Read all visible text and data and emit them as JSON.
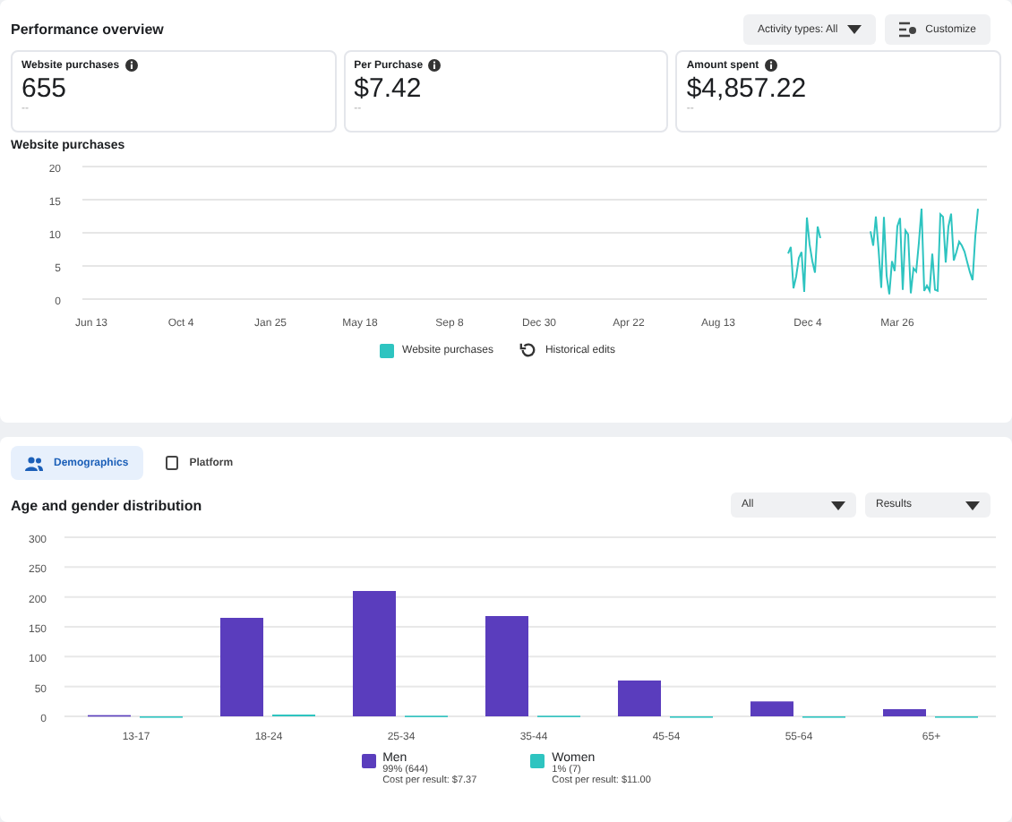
{
  "performance": {
    "title": "Performance overview",
    "activity_filter": "Activity types: All",
    "customize": "Customize",
    "metrics": [
      {
        "label": "Website purchases",
        "value": "655",
        "delta": "--"
      },
      {
        "label": "Per Purchase",
        "value": "$7.42",
        "delta": "--"
      },
      {
        "label": "Amount spent",
        "value": "$4,857.22",
        "delta": "--"
      }
    ],
    "trend": {
      "title": "Website purchases",
      "yticks": [
        "20",
        "15",
        "10",
        "5",
        "0"
      ],
      "xlabels": [
        "Jun 13",
        "Oct 4",
        "Jan 25",
        "May 18",
        "Sep 8",
        "Dec 30",
        "Apr 22",
        "Aug 13",
        "Dec 4",
        "Mar 26"
      ],
      "legend": [
        {
          "kind": "swatch",
          "label": "Website purchases",
          "color": "#2ec4c0"
        },
        {
          "kind": "history",
          "label": "Historical edits"
        }
      ]
    }
  },
  "breakdown": {
    "tabs": [
      {
        "label": "Demographics",
        "selected": true
      },
      {
        "label": "Platform",
        "selected": false
      }
    ],
    "title": "Age and gender distribution",
    "filters": [
      "All",
      "Results"
    ],
    "chart_data": {
      "type": "bar",
      "categories": [
        "13-17",
        "18-24",
        "25-34",
        "35-44",
        "45-54",
        "55-64",
        "65+"
      ],
      "series": [
        {
          "name": "Men",
          "color": "#5a3dbd",
          "values": [
            2,
            165,
            210,
            168,
            60,
            25,
            12
          ]
        },
        {
          "name": "Women",
          "color": "#2ec4c0",
          "values": [
            0,
            3,
            1,
            1,
            0,
            0,
            0
          ]
        }
      ],
      "grid": true,
      "ylim": [
        0,
        300
      ],
      "yticks": [
        0,
        50,
        100,
        150,
        200,
        250,
        300
      ]
    },
    "legend": [
      {
        "share": "99% (644)",
        "cost": "Cost per result: $7.37"
      },
      {
        "share": "1% (7)",
        "cost": "Cost per result: $11.00"
      }
    ]
  }
}
